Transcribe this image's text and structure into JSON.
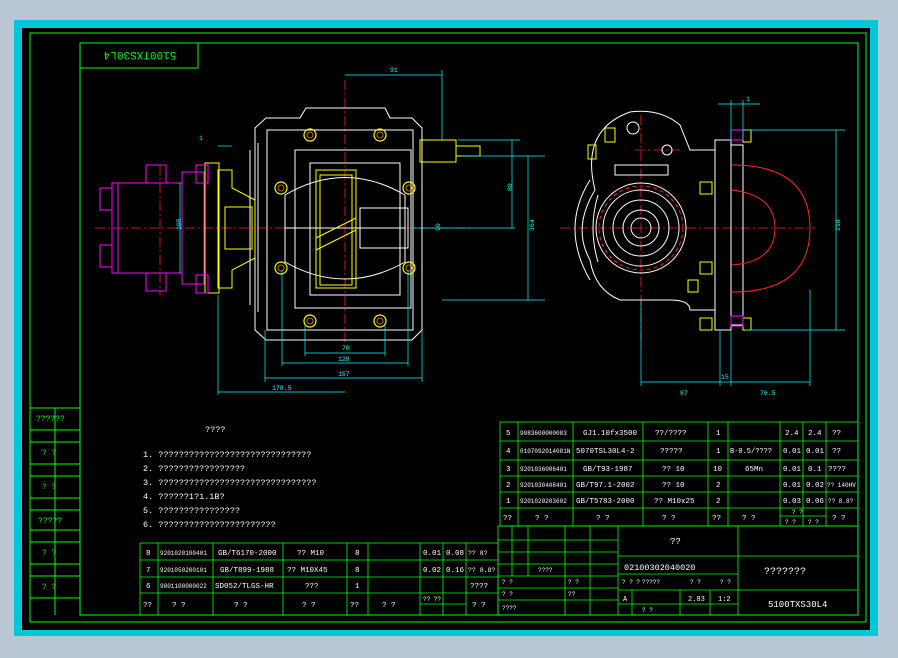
{
  "colors": {
    "bg_outer": "#b9c7d6",
    "bezel": "#00c8d8",
    "canvas": "#000000",
    "frame": "#00ff00",
    "dim": "#00ffff",
    "part": "#ffffff",
    "yellow": "#ffff00",
    "magenta": "#ff00ff",
    "red": "#ff2020",
    "orange": "#ff8800"
  },
  "title_stamp": "5100TXS30L4",
  "dimensions": {
    "d91": "91",
    "d1a": "1",
    "d80": "80",
    "d90": "90",
    "d164": "164",
    "d70": "70",
    "d128": "128",
    "d157": "157",
    "d1785": "178.5",
    "d105": "105",
    "d1b": "1",
    "d218": "218",
    "d87": "87",
    "d15": "15",
    "d765": "76.5"
  },
  "notes": {
    "heading": "????",
    "items": [
      "1. ??????????????????????????????",
      "2. ?????????????????",
      "3. ???????????????????????????????",
      "4. ??????1?1.1B?",
      "5. ????????????????",
      "6. ???????????????????????"
    ]
  },
  "side_labels": [
    "??????",
    "? ?",
    "? ?",
    "?????",
    "? ?",
    "? ?"
  ],
  "parts_top": [
    {
      "no": "5",
      "code": "9083600000083",
      "std": "GJ1.10fx3500",
      "name": "??/????",
      "qty": "1",
      "mat": "",
      "w1": "2.4",
      "w2": "2.4",
      "rem": "??"
    },
    {
      "no": "4",
      "code": "0107092014081N",
      "std": "5070TSL30L4-2",
      "name": "?????",
      "qty": "1",
      "mat": "B-0.5/????",
      "w1": "0.01",
      "w2": "0.01",
      "rem": "??"
    },
    {
      "no": "3",
      "code": "9201036006401",
      "std": "GB/T93-1987",
      "name": "?? 10",
      "qty": "10",
      "mat": "65Mn",
      "w1": "0.01",
      "w2": "0.1",
      "rem": "????"
    },
    {
      "no": "2",
      "code": "9201030408401",
      "std": "GB/T97.1-2002",
      "name": "?? 10",
      "qty": "2",
      "mat": "",
      "w1": "0.01",
      "w2": "0.02",
      "rem": "?? 140HV"
    },
    {
      "no": "1",
      "code": "9201020203602",
      "std": "GB/T5783-2000",
      "name": "?? M10x25",
      "qty": "2",
      "mat": "",
      "w1": "0.03",
      "w2": "0.06",
      "rem": "?? 8.8?"
    }
  ],
  "parts_top_header": {
    "no": "??",
    "code": "?  ?",
    "std": "?  ?",
    "name": "?  ?",
    "qty": "??",
    "mat": "?  ?",
    "w": "? ?",
    "w1": "? ?",
    "w2": "? ?",
    "rem": "?  ?"
  },
  "parts_bottom": [
    {
      "no": "8",
      "code": "9201020100401",
      "std": "GB/T6170-2000",
      "name": "?? M10",
      "qty": "8",
      "mat": "",
      "w1": "0.01",
      "w2": "0.08",
      "rem": "?? 8?"
    },
    {
      "no": "7",
      "code": "9201050200101",
      "std": "GB/T899-1988",
      "name": "?? M10X45",
      "qty": "8",
      "mat": "",
      "w1": "0.02",
      "w2": "0.16",
      "rem": "?? 8.8?"
    },
    {
      "no": "6",
      "code": "9801100000022",
      "std": "SD052/TLGS-HR",
      "name": "???",
      "qty": "1",
      "mat": "",
      "w1": "",
      "w2": "",
      "rem": "????"
    }
  ],
  "parts_bottom_header": {
    "no": "??",
    "code": "?  ?",
    "std": "?  ?",
    "name": "?  ?",
    "qty": "??",
    "mat": "?  ?",
    "w": "??  ??",
    "rem": "?  ?"
  },
  "title_block": {
    "unit": "??",
    "drawing_no": "02100302040020",
    "drawing_name": "???????",
    "model": "5100TXS30L4",
    "small_a": "A",
    "weight": "2.83",
    "scale": "1:2",
    "sheet": "? ?",
    "rev": "?????",
    "mark": "? ? ?",
    "c1": "? ?",
    "c2": "? ?",
    "c3": "????",
    "c4": "? ?",
    "c5": "????",
    "c6": "??",
    "c7": "? ?",
    "c8": "? ?"
  }
}
